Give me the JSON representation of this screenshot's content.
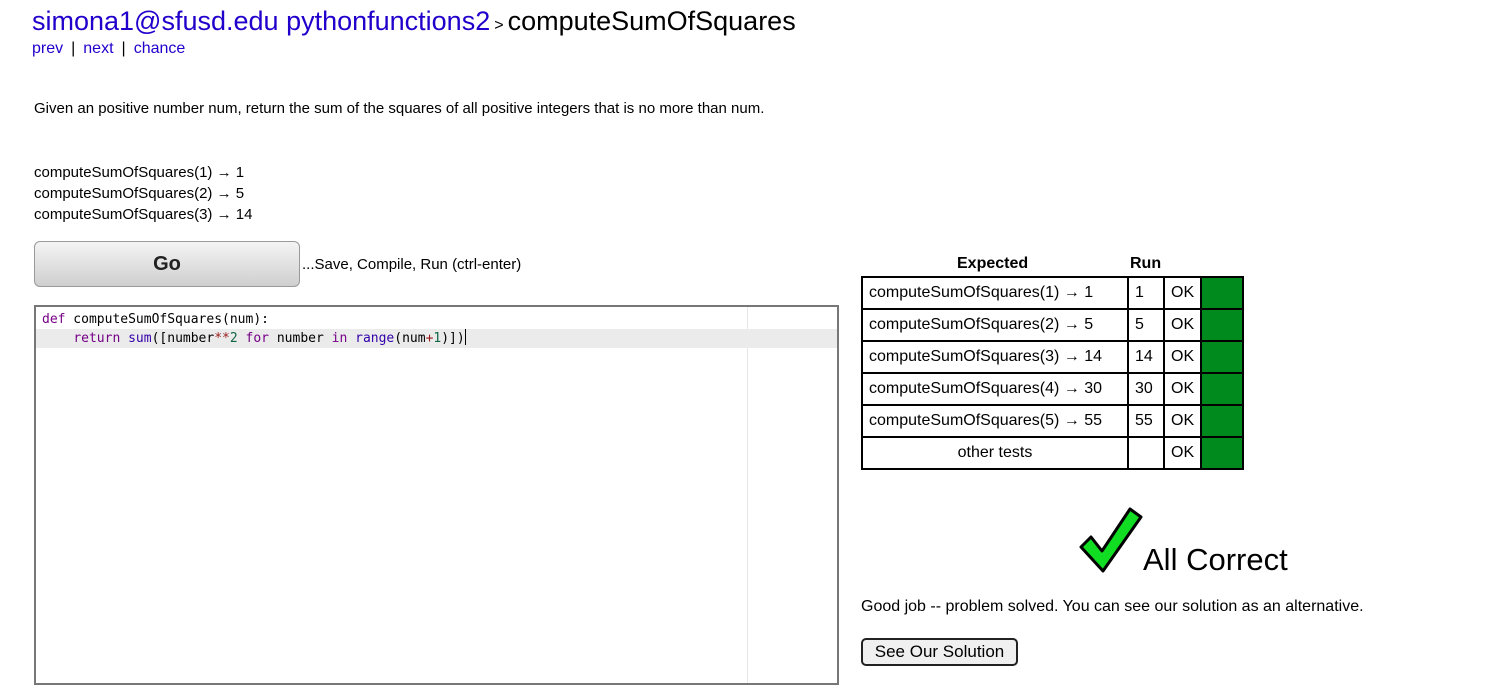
{
  "header": {
    "user": "simona1@sfusd.edu",
    "section": "pythonfunctions2",
    "separator": ">",
    "problem": "computeSumOfSquares"
  },
  "nav": {
    "prev": "prev",
    "next": "next",
    "chance": "chance",
    "divider": "|"
  },
  "description": "Given an positive number num, return the sum of the squares of all positive integers that is no more than num.",
  "examples": [
    "computeSumOfSquares(1) → 1",
    "computeSumOfSquares(2) → 5",
    "computeSumOfSquares(3) → 14"
  ],
  "go": {
    "label": "Go",
    "hint": "...Save, Compile, Run (ctrl-enter)"
  },
  "code": {
    "line1": {
      "kw": "def",
      "rest": " computeSumOfSquares(num):"
    },
    "line2": {
      "indent": "    ",
      "kw_return": "return",
      "sp1": " ",
      "bi_sum": "sum",
      "open": "([number",
      "op_pow": "**",
      "num2": "2",
      "sp2": " ",
      "kw_for": "for",
      "mid": " number ",
      "kw_in": "in",
      "sp3": " ",
      "bi_range": "range",
      "args_open": "(num",
      "op_plus": "+",
      "num1": "1",
      "close": ")])"
    }
  },
  "results": {
    "header_expected": "Expected",
    "header_run": "Run",
    "rows": [
      {
        "expected": "computeSumOfSquares(1) → 1",
        "run": "1",
        "result": "OK"
      },
      {
        "expected": "computeSumOfSquares(2) → 5",
        "run": "5",
        "result": "OK"
      },
      {
        "expected": "computeSumOfSquares(3) → 14",
        "run": "14",
        "result": "OK"
      },
      {
        "expected": "computeSumOfSquares(4) → 30",
        "run": "30",
        "result": "OK"
      },
      {
        "expected": "computeSumOfSquares(5) → 55",
        "run": "55",
        "result": "OK"
      },
      {
        "expected": "other tests",
        "run": "",
        "result": "OK"
      }
    ],
    "status_color": "#008a1d"
  },
  "verdict": {
    "icon": "green-checkmark-icon",
    "text": "All Correct",
    "message": "Good job -- problem solved. You can see our solution as an alternative.",
    "solution_button": "See Our Solution"
  }
}
